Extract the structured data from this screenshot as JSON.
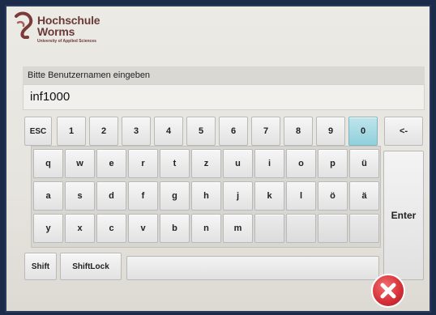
{
  "logo": {
    "line1": "Hochschule",
    "line2": "Worms",
    "tagline": "University of Applied Sciences"
  },
  "prompt": "Bitte Benutzernamen eingeben",
  "username_value": "inf1000",
  "keys": {
    "esc": "ESC",
    "digits": [
      "1",
      "2",
      "3",
      "4",
      "5",
      "6",
      "7",
      "8",
      "9",
      "0"
    ],
    "backspace": "<-",
    "row1": [
      "q",
      "w",
      "e",
      "r",
      "t",
      "z",
      "u",
      "i",
      "o",
      "p",
      "ü"
    ],
    "row2": [
      "a",
      "s",
      "d",
      "f",
      "g",
      "h",
      "j",
      "k",
      "l",
      "ö",
      "ä"
    ],
    "row3": [
      "y",
      "x",
      "c",
      "v",
      "b",
      "n",
      "m"
    ],
    "shift": "Shift",
    "shiftlock": "ShiftLock",
    "enter": "Enter"
  },
  "colors": {
    "active_key": "#8fd0dc",
    "close_button": "#d8323a"
  },
  "icons": {
    "close": "close-x-icon",
    "logo": "university-logo-mark"
  }
}
